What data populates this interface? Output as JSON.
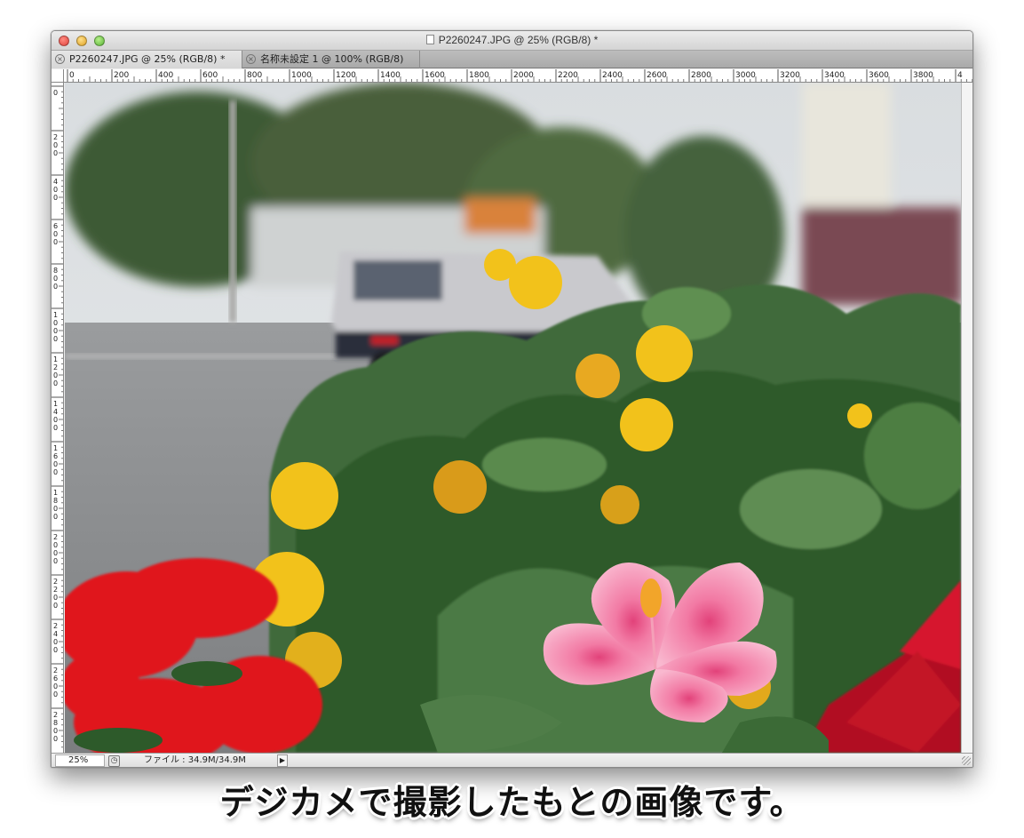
{
  "window": {
    "title": "P2260247.JPG @ 25% (RGB/8) *"
  },
  "tabs": [
    {
      "label": "P2260247.JPG @ 25% (RGB/8) *",
      "active": true
    },
    {
      "label": "名称未設定 1 @ 100% (RGB/8)",
      "active": false
    }
  ],
  "ruler": {
    "top_labels": [
      "0",
      "200",
      "400",
      "600",
      "800",
      "1000",
      "1200",
      "1400",
      "1600",
      "1800",
      "2000",
      "2200",
      "2400",
      "2600",
      "2800",
      "3000",
      "3200",
      "3400",
      "3600",
      "3800",
      "4"
    ],
    "left_labels": [
      "0",
      "2\n0\n0",
      "4\n0\n0",
      "6\n0\n0",
      "8\n0\n0",
      "1\n0\n0\n0",
      "1\n2\n0\n0",
      "1\n4\n0\n0",
      "1\n6\n0\n0",
      "1\n8\n0\n0",
      "2\n0\n0\n0",
      "2\n2\n0\n0",
      "2\n4\n0\n0",
      "2\n6\n0\n0",
      "2\n8\n0\n0"
    ]
  },
  "status": {
    "zoom": "25%",
    "file_info": "ファイル : 34.9M/34.9M"
  },
  "caption": "デジカメで撮影したもとの画像です。",
  "colors": {
    "sky": "#dfe3e6",
    "road": "#8d8f92",
    "foliage": "#3f6b3a",
    "marigold": "#f2c21b",
    "hibiscus": "#f4a3c0",
    "red_flowers": "#e0151c",
    "poinsettia": "#c4102a"
  }
}
